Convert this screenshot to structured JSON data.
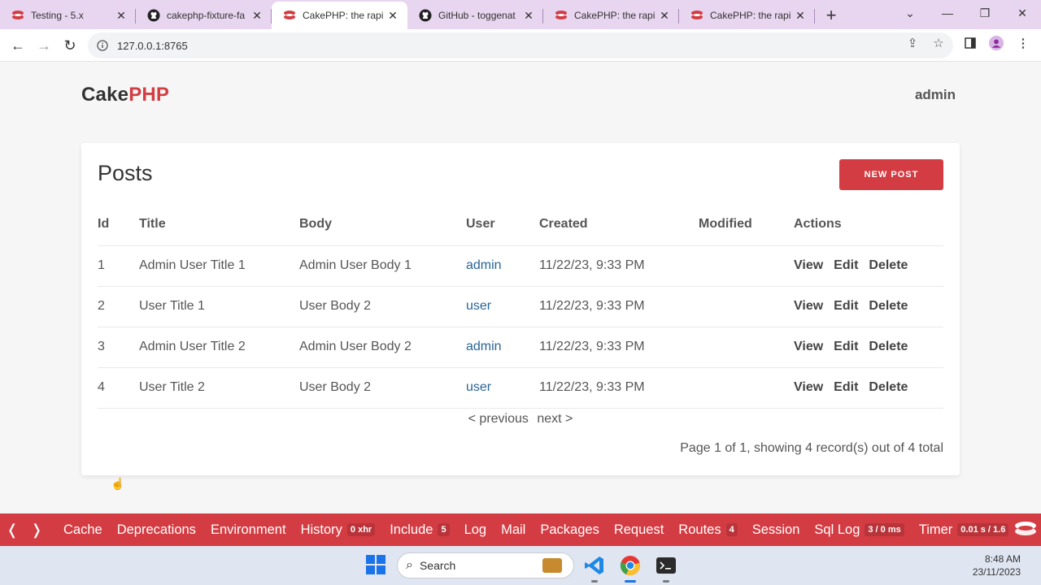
{
  "browser": {
    "tabs": [
      {
        "label": "Testing - 5.x",
        "icon": "cakephp-favicon"
      },
      {
        "label": "cakephp-fixture-fa",
        "icon": "github-icon"
      },
      {
        "label": "CakePHP: the rapi",
        "icon": "cakephp-favicon",
        "active": true
      },
      {
        "label": "GitHub - toggenat",
        "icon": "github-icon"
      },
      {
        "label": "CakePHP: the rapi",
        "icon": "cakephp-favicon"
      },
      {
        "label": "CakePHP: the rapi",
        "icon": "cakephp-favicon"
      }
    ],
    "url": "127.0.0.1:8765"
  },
  "page": {
    "brand_cake": "Cake",
    "brand_php": "PHP",
    "user": "admin",
    "heading": "Posts",
    "new_post": "NEW POST",
    "columns": [
      "Id",
      "Title",
      "Body",
      "User",
      "Created",
      "Modified",
      "Actions"
    ],
    "rows": [
      {
        "id": "1",
        "title": "Admin User Title 1",
        "body": "Admin User Body 1",
        "user": "admin",
        "created": "11/22/23, 9:33 PM",
        "modified": ""
      },
      {
        "id": "2",
        "title": "User Title 1",
        "body": "User Body 2",
        "user": "user",
        "created": "11/22/23, 9:33 PM",
        "modified": ""
      },
      {
        "id": "3",
        "title": "Admin User Title 2",
        "body": "Admin User Body 2",
        "user": "admin",
        "created": "11/22/23, 9:33 PM",
        "modified": ""
      },
      {
        "id": "4",
        "title": "User Title 2",
        "body": "User Body 2",
        "user": "user",
        "created": "11/22/23, 9:33 PM",
        "modified": ""
      }
    ],
    "actions": {
      "view": "View",
      "edit": "Edit",
      "delete": "Delete"
    },
    "pager": {
      "prev": "< previous",
      "next": "next >"
    },
    "counter": "Page 1 of 1, showing 4 record(s) out of 4 total"
  },
  "debugkit": {
    "left_arrow": "❬",
    "right_arrow": "❭",
    "panels": [
      {
        "label": "Cache",
        "badge": ""
      },
      {
        "label": "Deprecations",
        "badge": ""
      },
      {
        "label": "Environment",
        "badge": ""
      },
      {
        "label": "History",
        "badge": "0 xhr"
      },
      {
        "label": "Include",
        "badge": "5"
      },
      {
        "label": "Log",
        "badge": ""
      },
      {
        "label": "Mail",
        "badge": ""
      },
      {
        "label": "Packages",
        "badge": ""
      },
      {
        "label": "Request",
        "badge": ""
      },
      {
        "label": "Routes",
        "badge": "4"
      },
      {
        "label": "Session",
        "badge": ""
      },
      {
        "label": "Sql Log",
        "badge": "3 / 0 ms"
      },
      {
        "label": "Timer",
        "badge": "0.01 s / 1.6"
      }
    ],
    "accent": "#d33c43"
  },
  "taskbar": {
    "search_label": "Search",
    "time": "8:48 AM",
    "date": "23/11/2023"
  }
}
